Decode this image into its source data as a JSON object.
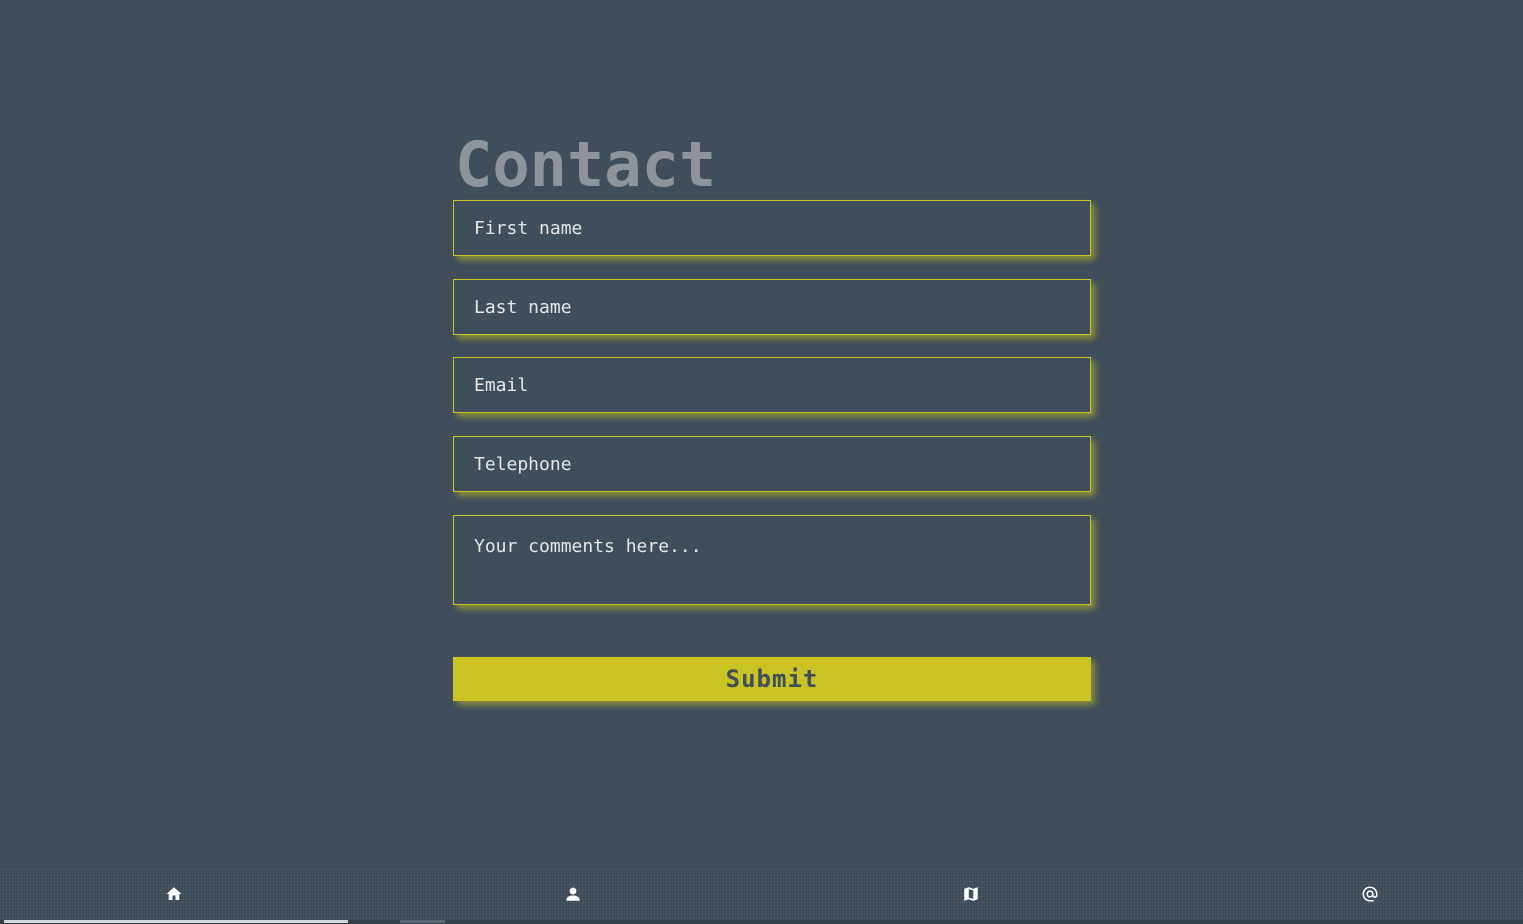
{
  "page": {
    "title": "Contact"
  },
  "form": {
    "first_name_placeholder": "First name",
    "last_name_placeholder": "Last name",
    "email_placeholder": "Email",
    "telephone_placeholder": "Telephone",
    "comments_placeholder": "Your comments here...",
    "submit_label": "Submit"
  },
  "nav": {
    "items": [
      {
        "icon": "home-icon"
      },
      {
        "icon": "user-icon"
      },
      {
        "icon": "map-icon"
      },
      {
        "icon": "at-icon"
      }
    ]
  },
  "colors": {
    "background": "#404d5b",
    "accent": "#c9c423",
    "title": "#8f949b",
    "text": "#e6e6e6"
  }
}
